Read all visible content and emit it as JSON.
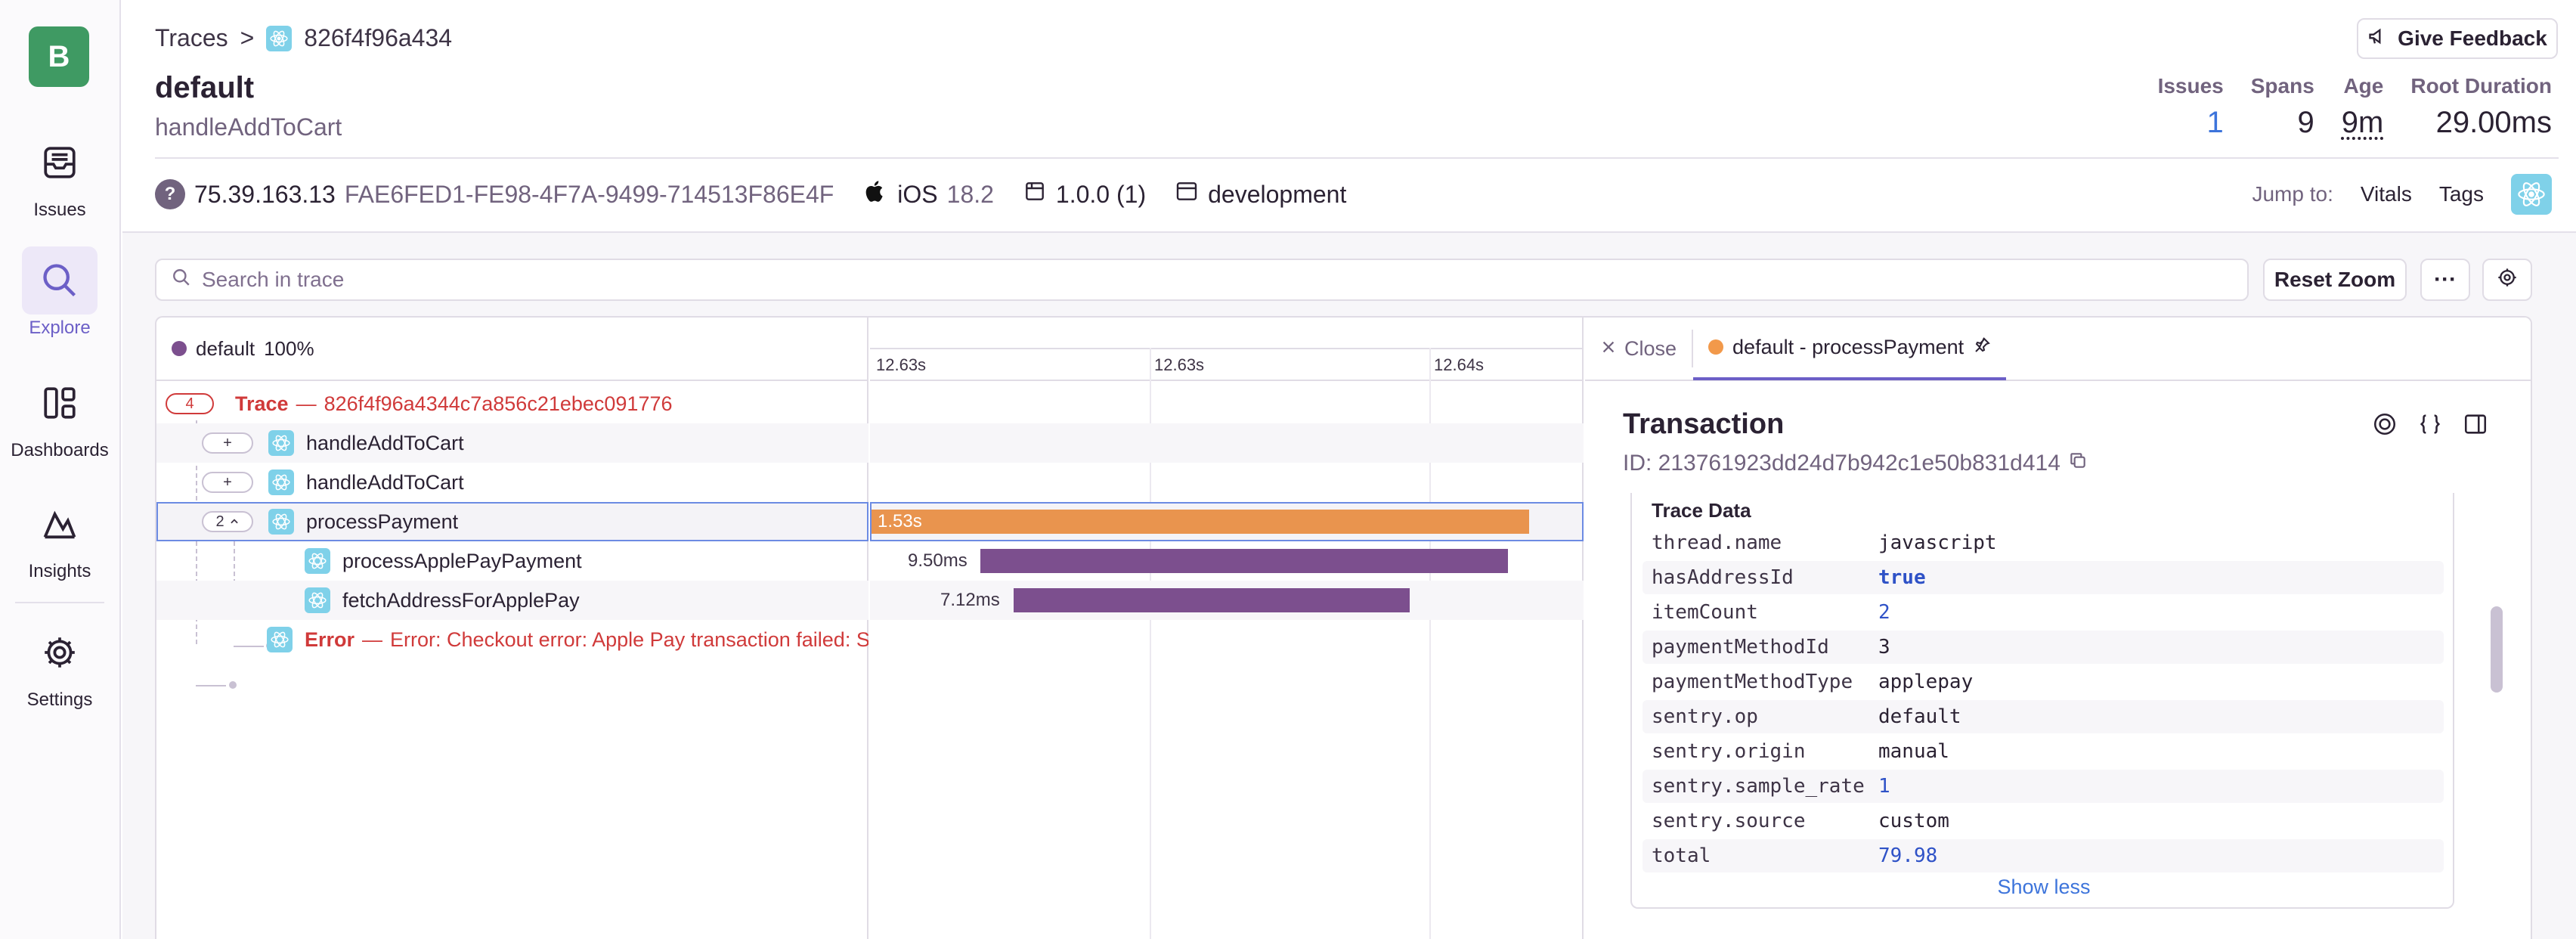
{
  "sidebar": {
    "org_initial": "B",
    "items": [
      {
        "label": "Issues",
        "icon": "inbox-icon"
      },
      {
        "label": "Explore",
        "icon": "search-icon",
        "active": true
      },
      {
        "label": "Dashboards",
        "icon": "dashboard-icon"
      },
      {
        "label": "Insights",
        "icon": "insights-icon"
      },
      {
        "label": "Settings",
        "icon": "gear-icon"
      }
    ]
  },
  "breadcrumb": {
    "root": "Traces",
    "separator": ">",
    "current": "826f4f96a434"
  },
  "header": {
    "title": "default",
    "subtitle": "handleAddToCart",
    "feedback_label": "Give Feedback"
  },
  "stats": [
    {
      "label": "Issues",
      "value": "1"
    },
    {
      "label": "Spans",
      "value": "9"
    },
    {
      "label": "Age",
      "value": "9m"
    },
    {
      "label": "Root Duration",
      "value": "29.00ms"
    }
  ],
  "meta": {
    "ip": "75.39.163.13",
    "device_id": "FAE6FED1-FE98-4F7A-9499-714513F86E4F",
    "os_name": "iOS",
    "os_version": "18.2",
    "release": "1.0.0 (1)",
    "environment": "development"
  },
  "jump": {
    "label": "Jump to:",
    "vitals": "Vitals",
    "tags": "Tags"
  },
  "toolbar": {
    "search_placeholder": "Search in trace",
    "reset_zoom": "Reset Zoom",
    "more": "···"
  },
  "waterfall": {
    "legend_name": "default",
    "legend_pct": "100%",
    "ticks": [
      "12.63s",
      "12.63s",
      "12.64s"
    ],
    "trace_row": {
      "count": "4",
      "label": "Trace",
      "dash": "—",
      "id": "826f4f96a4344c7a856c21ebec091776"
    },
    "rows": [
      {
        "toggle": "+",
        "name": "handleAddToCart"
      },
      {
        "toggle": "+",
        "name": "handleAddToCart"
      },
      {
        "toggle": "2",
        "name": "processPayment",
        "bar_label": "1.53s"
      },
      {
        "name": "processApplePayPayment",
        "bar_label": "9.50ms"
      },
      {
        "name": "fetchAddressForApplePay",
        "bar_label": "7.12ms"
      }
    ],
    "error_row": {
      "label": "Error",
      "dash": "—",
      "message": "Error: Checkout error: Apple Pay transaction failed: SI"
    },
    "colors": {
      "selected_bar": "#e9944e",
      "child_bar": "#7c4f8e"
    }
  },
  "detail": {
    "close_label": "Close",
    "tab_label": "default - processPayment",
    "title": "Transaction",
    "id_label": "ID: 213761923dd24d7b942c1e50b831d414",
    "section_title": "Trace Data",
    "data": [
      {
        "key": "thread.name",
        "value": "javascript",
        "kind": "str"
      },
      {
        "key": "hasAddressId",
        "value": "true",
        "kind": "bool"
      },
      {
        "key": "itemCount",
        "value": "2",
        "kind": "num"
      },
      {
        "key": "paymentMethodId",
        "value": "3",
        "kind": "num"
      },
      {
        "key": "paymentMethodType",
        "value": "applepay",
        "kind": "str"
      },
      {
        "key": "sentry.op",
        "value": "default",
        "kind": "str"
      },
      {
        "key": "sentry.origin",
        "value": "manual",
        "kind": "str"
      },
      {
        "key": "sentry.sample_rate",
        "value": "1",
        "kind": "num"
      },
      {
        "key": "sentry.source",
        "value": "custom",
        "kind": "str"
      },
      {
        "key": "total",
        "value": "79.98",
        "kind": "num"
      }
    ],
    "show_less": "Show less"
  }
}
